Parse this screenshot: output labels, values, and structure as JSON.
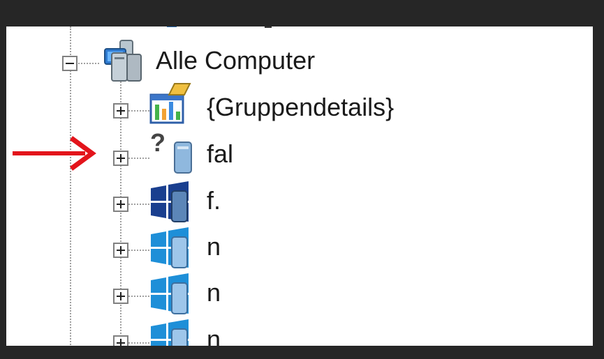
{
  "tree": {
    "root": {
      "label": "Alle Computer",
      "icon": "computer-group-icon",
      "expanded": true
    },
    "children": [
      {
        "label": "{Gruppendetails}",
        "icon": "group-details-icon",
        "expanded": false
      },
      {
        "label": "fal",
        "icon": "unknown-computer-icon",
        "expanded": false
      },
      {
        "label": "f.",
        "icon": "windows-computer-icon",
        "expanded": false
      },
      {
        "label": "n",
        "icon": "windows-computer-icon",
        "expanded": false
      },
      {
        "label": "n",
        "icon": "windows-computer-icon",
        "expanded": false
      },
      {
        "label": "n",
        "icon": "windows-computer-icon",
        "expanded": false
      }
    ]
  },
  "annotation": {
    "arrow_color": "#e3141b"
  },
  "colors": {
    "frame": "#262626",
    "text": "#1a1a1a",
    "windows_blue": "#1e8fd8"
  }
}
